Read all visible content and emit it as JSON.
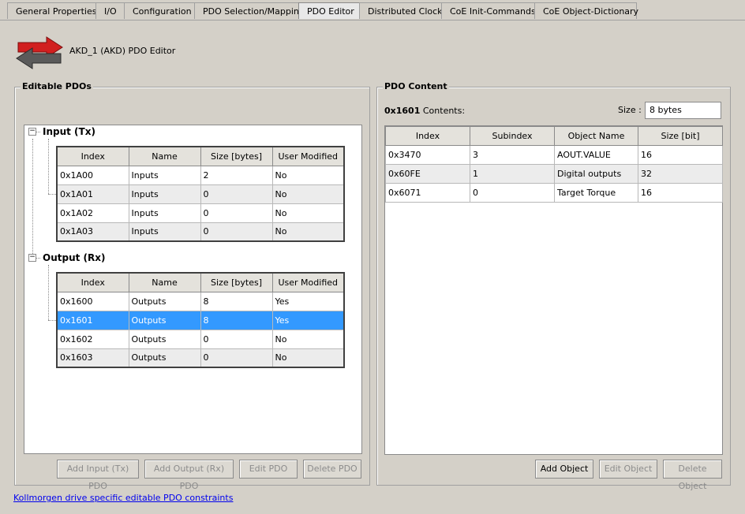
{
  "tabs": [
    {
      "label": "General Properties"
    },
    {
      "label": "I/O"
    },
    {
      "label": "Configuration"
    },
    {
      "label": "PDO Selection/Mapping"
    },
    {
      "label": "PDO Editor"
    },
    {
      "label": "Distributed Clock"
    },
    {
      "label": "CoE Init-Commands"
    },
    {
      "label": "CoE Object-Dictionary"
    }
  ],
  "active_tab": "PDO Editor",
  "header": {
    "title": "AKD_1 (AKD) PDO Editor",
    "icon": "arrows-icon"
  },
  "editable": {
    "title": "Editable PDOs",
    "columns": [
      "Index",
      "Name",
      "Size [bytes]",
      "User Modified"
    ],
    "input_node": "Input (Tx)",
    "output_node": "Output (Rx)",
    "inputs": [
      [
        "0x1A00",
        "Inputs",
        "2",
        "No"
      ],
      [
        "0x1A01",
        "Inputs",
        "0",
        "No"
      ],
      [
        "0x1A02",
        "Inputs",
        "0",
        "No"
      ],
      [
        "0x1A03",
        "Inputs",
        "0",
        "No"
      ]
    ],
    "outputs": [
      [
        "0x1600",
        "Outputs",
        "8",
        "Yes"
      ],
      [
        "0x1601",
        "Outputs",
        "8",
        "Yes"
      ],
      [
        "0x1602",
        "Outputs",
        "0",
        "No"
      ],
      [
        "0x1603",
        "Outputs",
        "0",
        "No"
      ]
    ],
    "selected_output_row": 1,
    "buttons": {
      "add_input": "Add Input (Tx) PDO",
      "add_output": "Add Output (Rx) PDO",
      "edit": "Edit PDO",
      "delete": "Delete PDO"
    }
  },
  "content": {
    "title": "PDO Content",
    "pdo_index": "0x1601",
    "contents_label": "Contents:",
    "size_label": "Size :",
    "size_value": "8 bytes",
    "columns": [
      "Index",
      "Subindex",
      "Object Name",
      "Size [bit]"
    ],
    "rows": [
      [
        "0x3470",
        "3",
        "AOUT.VALUE",
        "16"
      ],
      [
        "0x60FE",
        "1",
        "Digital outputs",
        "32"
      ],
      [
        "0x6071",
        "0",
        "Target Torque",
        "16"
      ]
    ],
    "buttons": {
      "add": "Add Object",
      "edit": "Edit Object",
      "delete": "Delete Object"
    }
  },
  "footer_link": "Kollmorgen drive specific editable PDO constraints"
}
